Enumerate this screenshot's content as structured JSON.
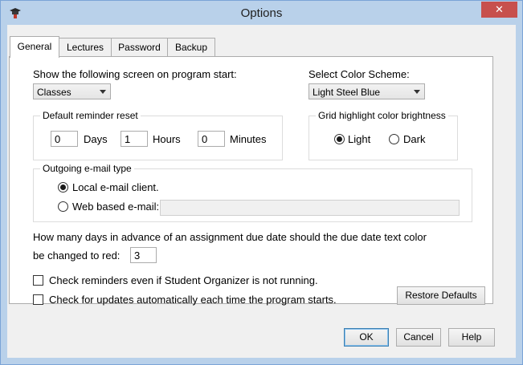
{
  "window": {
    "title": "Options",
    "close_glyph": "✕"
  },
  "tabs": [
    {
      "label": "General",
      "active": true
    },
    {
      "label": "Lectures",
      "active": false
    },
    {
      "label": "Password",
      "active": false
    },
    {
      "label": "Backup",
      "active": false
    }
  ],
  "startup": {
    "label": "Show the following screen on program start:",
    "value": "Classes"
  },
  "color_scheme": {
    "label": "Select Color Scheme:",
    "value": "Light Steel Blue"
  },
  "reminder_reset": {
    "legend": "Default reminder reset",
    "days_value": "0",
    "days_label": "Days",
    "hours_value": "1",
    "hours_label": "Hours",
    "minutes_value": "0",
    "minutes_label": "Minutes"
  },
  "grid_brightness": {
    "legend": "Grid highlight color brightness",
    "light_label": "Light",
    "dark_label": "Dark",
    "selected": "Light"
  },
  "email": {
    "legend": "Outgoing e-mail type",
    "local_label": "Local e-mail client.",
    "web_label": "Web based e-mail:",
    "web_value": "",
    "selected": "local"
  },
  "due_date": {
    "question_line1": "How many days in advance of an assignment due date should the due date text color",
    "question_line2": "be changed to red:",
    "value": "3"
  },
  "options": {
    "check_reminders_label": "Check reminders even if Student Organizer is not running.",
    "check_reminders_checked": false,
    "check_updates_label": "Check for updates automatically each time the program starts.",
    "check_updates_checked": false
  },
  "buttons": {
    "restore_defaults": "Restore Defaults",
    "ok": "OK",
    "cancel": "Cancel",
    "help": "Help"
  },
  "icons": {
    "app": "graduation-cap-icon",
    "close": "close-icon"
  }
}
